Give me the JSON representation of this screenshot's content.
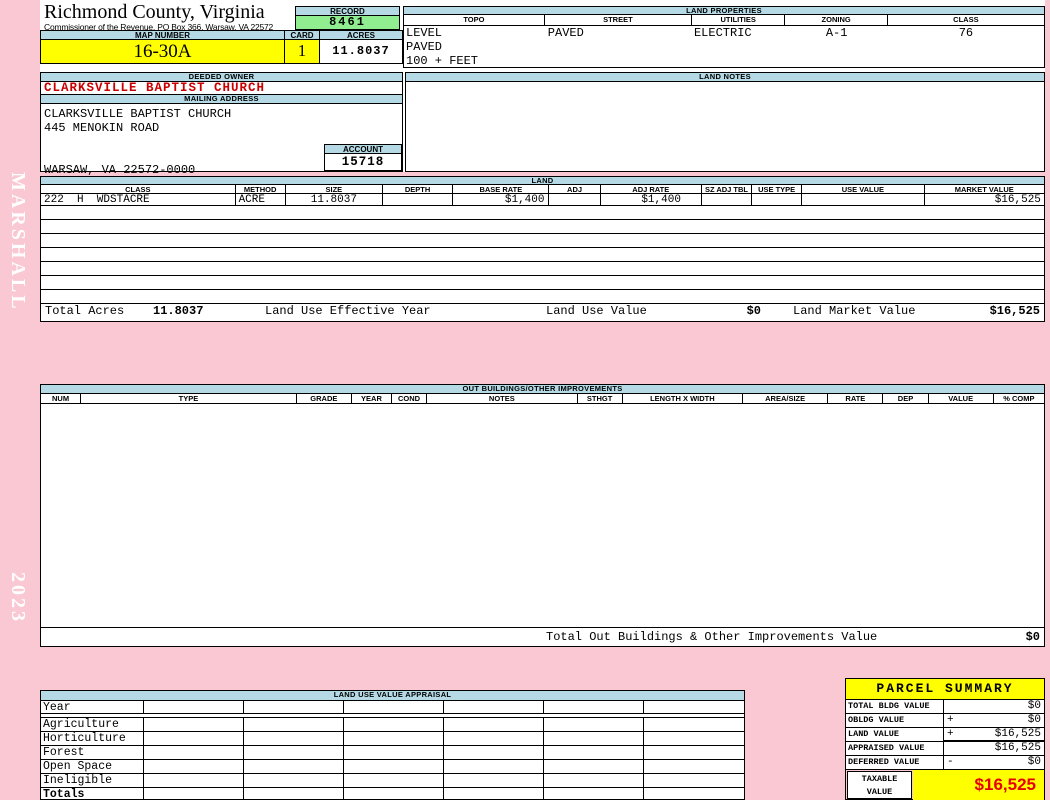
{
  "colors": {
    "page_pink": "#f9c8d3",
    "header_blue": "#b5dae6",
    "record_green": "#90ee90",
    "highlight_yellow": "#ffff00",
    "owner_red": "#cc0000",
    "taxable_red": "#e80000"
  },
  "sidebar": {
    "book_name": "MARSHALL",
    "year": "2023"
  },
  "header": {
    "title": "Richmond County, Virginia",
    "subtitle": "Commissioner of the Revenue, PO Box 366, Warsaw, VA 22572",
    "record_label": "RECORD",
    "record_value": "8461",
    "map_number_label": "MAP NUMBER",
    "map_number_value": "16-30A",
    "card_label": "CARD",
    "card_value": "1",
    "acres_label": "ACRES",
    "acres_value": "11.8037"
  },
  "land_properties": {
    "title": "LAND PROPERTIES",
    "columns": [
      "TOPO",
      "STREET",
      "UTILITIES",
      "ZONING",
      "CLASS"
    ],
    "topo_lines": "LEVEL\nPAVED\n100 + FEET",
    "street": "PAVED",
    "utilities": "ELECTRIC",
    "zoning": "A-1",
    "class": "76"
  },
  "owner": {
    "deeded_owner_label": "DEEDED OWNER",
    "deeded_owner": "CLARKSVILLE BAPTIST CHURCH",
    "mailing_address_label": "MAILING ADDRESS",
    "address_line1": "CLARKSVILLE BAPTIST CHURCH",
    "address_line2": "445 MENOKIN ROAD",
    "address_line3": "",
    "address_line4": "WARSAW, VA 22572-0000",
    "account_label": "ACCOUNT",
    "account_value": "15718"
  },
  "land_notes": {
    "title": "LAND NOTES",
    "content": ""
  },
  "land": {
    "title": "LAND",
    "columns": [
      "CLASS",
      "METHOD",
      "SIZE",
      "DEPTH",
      "BASE RATE",
      "ADJ",
      "ADJ RATE",
      "SZ ADJ TBL",
      "USE TYPE",
      "USE VALUE",
      "MARKET VALUE"
    ],
    "rows": [
      [
        "222  H  WDSTACRE",
        "ACRE",
        "11.8037",
        "",
        "$1,400",
        "",
        "$1,400",
        "",
        "",
        "",
        "$16,525"
      ]
    ],
    "totals": {
      "total_acres_label": "Total Acres",
      "total_acres": "11.8037",
      "effective_year_label": "Land Use Effective Year",
      "effective_year": "",
      "use_value_label": "Land Use Value",
      "use_value": "$0",
      "market_value_label": "Land Market Value",
      "market_value": "$16,525"
    }
  },
  "out_buildings": {
    "title": "OUT BUILDINGS/OTHER IMPROVEMENTS",
    "columns": [
      "NUM",
      "TYPE",
      "GRADE",
      "YEAR",
      "COND",
      "NOTES",
      "STHGT",
      "LENGTH X WIDTH",
      "AREA/SIZE",
      "RATE",
      "DEP",
      "VALUE",
      "% COMP"
    ],
    "total_label": "Total Out Buildings & Other Improvements Value",
    "total_value": "$0"
  },
  "appraisal": {
    "title": "LAND USE VALUE APPRAISAL",
    "row_labels": [
      "Year",
      "Agriculture",
      "Horticulture",
      "Forest",
      "Open Space",
      "Ineligible",
      "Totals"
    ]
  },
  "parcel_summary": {
    "title": "PARCEL SUMMARY",
    "rows": [
      {
        "label": "TOTAL BLDG VALUE",
        "op": "",
        "value": "$0"
      },
      {
        "label": "OBLDG VALUE",
        "op": "+",
        "value": "$0"
      },
      {
        "label": "LAND VALUE",
        "op": "+",
        "value": "$16,525"
      },
      {
        "label": "APPRAISED VALUE",
        "op": "",
        "value": "$16,525"
      },
      {
        "label": "DEFERRED VALUE",
        "op": "-",
        "value": "$0"
      }
    ],
    "taxable_label": "TAXABLE VALUE",
    "taxable_value": "$16,525"
  }
}
